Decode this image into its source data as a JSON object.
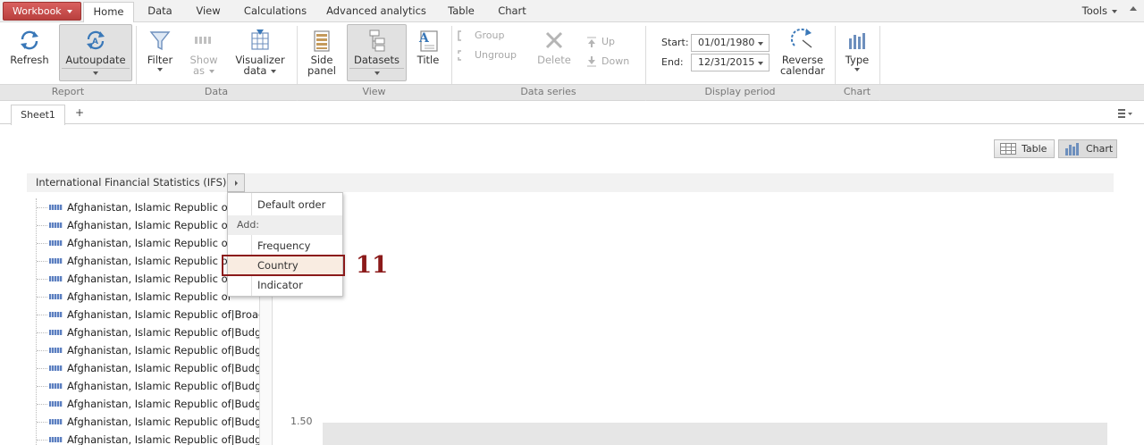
{
  "menubar": {
    "workbook_label": "Workbook",
    "tabs": [
      "Home",
      "Data",
      "View",
      "Calculations",
      "Advanced analytics",
      "Table",
      "Chart"
    ],
    "active_tab": "Home",
    "tools_label": "Tools"
  },
  "ribbon": {
    "refresh": "Refresh",
    "autoupdate": "Autoupdate",
    "filter": "Filter",
    "show_as_1": "Show",
    "show_as_2": "as",
    "visualizer_1": "Visualizer",
    "visualizer_2": "data",
    "side_panel_1": "Side",
    "side_panel_2": "panel",
    "datasets": "Datasets",
    "title": "Title",
    "group": "Group",
    "ungroup": "Ungroup",
    "delete": "Delete",
    "up": "Up",
    "down": "Down",
    "start_label": "Start:",
    "start_value": "01/01/1980",
    "end_label": "End:",
    "end_value": "12/31/2015",
    "reverse_1": "Reverse",
    "reverse_2": "calendar",
    "type": "Type",
    "groups": {
      "report": "Report",
      "data": "Data",
      "view": "View",
      "data_series": "Data series",
      "display_period": "Display period",
      "chart": "Chart"
    }
  },
  "sheets": {
    "active": "Sheet1",
    "add": "+"
  },
  "view_buttons": {
    "table": "Table",
    "chart": "Chart"
  },
  "dataset_title": "International Financial Statistics (IFS)",
  "tree_rows": [
    {
      "left": "Afghanistan, Islamic Republic of",
      "right": ""
    },
    {
      "left": "Afghanistan, Islamic Republic of",
      "right": ""
    },
    {
      "left": "Afghanistan, Islamic Republic of",
      "right": ""
    },
    {
      "left": "Afghanistan, Islamic Republic of",
      "right": ""
    },
    {
      "left": "Afghanistan, Islamic Republic of",
      "right": ""
    },
    {
      "left": "Afghanistan, Islamic Republic of",
      "right": ""
    },
    {
      "left": "Afghanistan, Islamic Republic of",
      "right": "Broad"
    },
    {
      "left": "Afghanistan, Islamic Republic of",
      "right": "Budge"
    },
    {
      "left": "Afghanistan, Islamic Republic of",
      "right": "Budge"
    },
    {
      "left": "Afghanistan, Islamic Republic of",
      "right": "Budge"
    },
    {
      "left": "Afghanistan, Islamic Republic of",
      "right": "Budge"
    },
    {
      "left": "Afghanistan, Islamic Republic of",
      "right": "Budge"
    },
    {
      "left": "Afghanistan, Islamic Republic of",
      "right": "Budge"
    },
    {
      "left": "Afghanistan, Islamic Republic of",
      "right": "Budge"
    }
  ],
  "popup": {
    "default_order": "Default order",
    "add_header": "Add:",
    "frequency": "Frequency",
    "country": "Country",
    "indicator": "Indicator"
  },
  "chart_y_tick": "1.50",
  "callout_number": "11",
  "colors": {
    "workbook": "#c44e4c",
    "callout": "#8b1a1a",
    "highlight": "#f9ece1",
    "series_icon": "#5b7fc0"
  }
}
